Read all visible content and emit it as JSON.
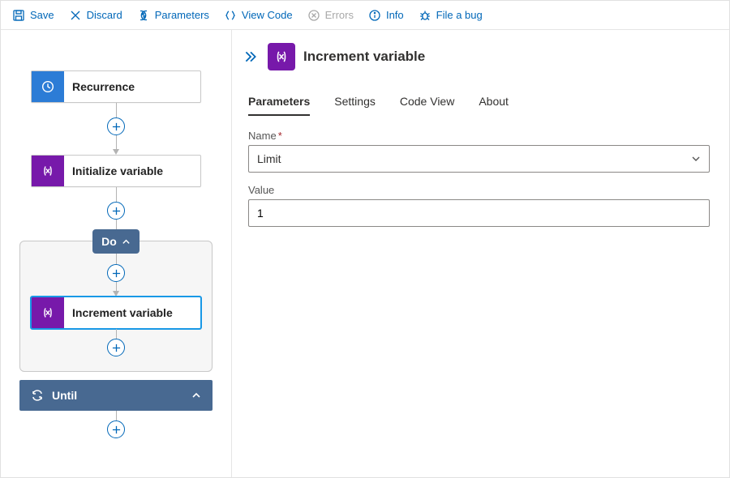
{
  "toolbar": {
    "save": "Save",
    "discard": "Discard",
    "parameters": "Parameters",
    "view_code": "View Code",
    "errors": "Errors",
    "info": "Info",
    "file_bug": "File a bug"
  },
  "flow": {
    "recurrence": "Recurrence",
    "initialize": "Initialize variable",
    "do": "Do",
    "increment": "Increment variable",
    "until": "Until"
  },
  "panel": {
    "title": "Increment variable",
    "tabs": {
      "parameters": "Parameters",
      "settings": "Settings",
      "code_view": "Code View",
      "about": "About"
    },
    "name_label": "Name",
    "name_value": "Limit",
    "value_label": "Value",
    "value_value": "1"
  }
}
